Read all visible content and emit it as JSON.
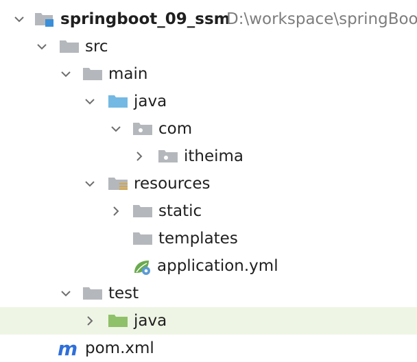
{
  "project": {
    "name": "springboot_09_ssm",
    "path": "D:\\workspace\\springBoo"
  },
  "tree": {
    "src": "src",
    "main": "main",
    "java_main": "java",
    "com": "com",
    "itheima": "itheima",
    "resources": "resources",
    "static": "static",
    "templates": "templates",
    "application": "application.yml",
    "test": "test",
    "java_test": "java",
    "pom": "pom.xml"
  },
  "colors": {
    "folder_gray": "#b4b7bb",
    "folder_source": "#73b9e3",
    "folder_test": "#8fc06a",
    "selection": "#eef5e4",
    "maven": "#2f6fd9"
  }
}
